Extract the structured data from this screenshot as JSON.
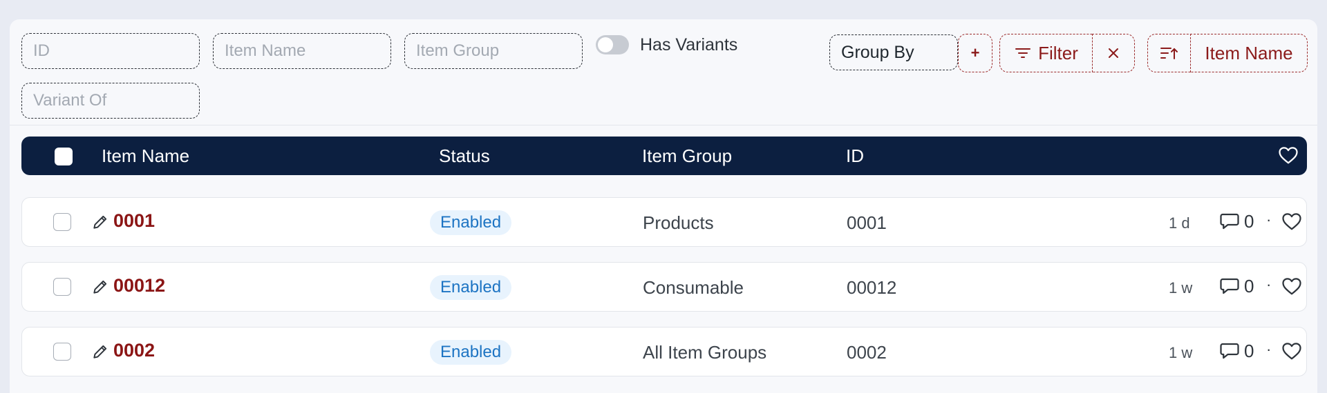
{
  "filters": {
    "id_placeholder": "ID",
    "item_name_placeholder": "Item Name",
    "item_group_placeholder": "Item Group",
    "variant_of_placeholder": "Variant Of",
    "has_variants_label": "Has Variants",
    "has_variants_on": false
  },
  "toolbar": {
    "group_by_label": "Group By",
    "add_label": "+",
    "filter_label": "Filter",
    "sort_label": "Item Name"
  },
  "table": {
    "columns": {
      "item_name": "Item Name",
      "status": "Status",
      "item_group": "Item Group",
      "id": "ID"
    },
    "rows": [
      {
        "name": "0001",
        "status": "Enabled",
        "item_group": "Products",
        "id": "0001",
        "modified": "1 d",
        "comments": "0"
      },
      {
        "name": "00012",
        "status": "Enabled",
        "item_group": "Consumable",
        "id": "00012",
        "modified": "1 w",
        "comments": "0"
      },
      {
        "name": "0002",
        "status": "Enabled",
        "item_group": "All Item Groups",
        "id": "0002",
        "modified": "1 w",
        "comments": "0"
      }
    ],
    "separator": "·"
  },
  "colors": {
    "header_bg": "#0c1f40",
    "link_red": "#8b1515",
    "badge_bg": "#e8f3fd",
    "badge_text": "#1d74c3"
  },
  "icons": {
    "filter": "filter-icon",
    "clear": "close-icon",
    "sort": "sort-ascending-icon",
    "edit": "pencil-icon",
    "comment": "comment-icon",
    "like": "heart-icon"
  }
}
